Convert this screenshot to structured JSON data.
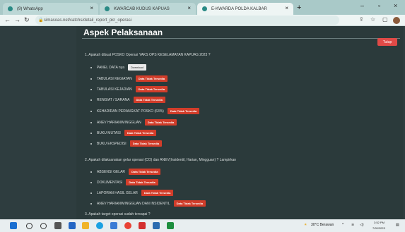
{
  "browser": {
    "tabs": [
      {
        "label": "(9) WhatsApp"
      },
      {
        "label": "KWARCAB KUDUS KAPUAS"
      },
      {
        "label": "E-KWARDA POLDA KALBAR"
      }
    ],
    "new_tab": "+",
    "url": "simasoas.net/catchs/detail_report_pkr_operasi"
  },
  "page": {
    "title": "Aspek Pelaksanaan",
    "close_button": "Tutup",
    "q1": "1. Apakah dibuat POSKO Operasi YAKS OPS KESELAMATAN KAPUAS 2023 ?",
    "q1_items": [
      {
        "label": "PANEL DATA nya",
        "action": "Download",
        "type": "download"
      },
      {
        "label": "TABULASI KEGIATAN",
        "action": "Data Tidak Tersedia",
        "type": "badge"
      },
      {
        "label": "TABULASI KEJADIAN",
        "action": "Data Tidak Tersedia",
        "type": "badge"
      },
      {
        "label": "RENGIAT / SARANA",
        "action": "Data Tidak Tersedia",
        "type": "badge"
      },
      {
        "label": "KEHADIRAN PERANGKAT POSKO (63%)",
        "action": "Data Tidak Tersedia",
        "type": "badge"
      },
      {
        "label": "ANEV HARIAN/MINGGUAN",
        "action": "Data Tidak Tersedia",
        "type": "badge"
      },
      {
        "label": "BUKU MUTASI",
        "action": "Data Tidak Tersedia",
        "type": "badge"
      },
      {
        "label": "BUKU EKSPEDISI",
        "action": "Data Tidak Tersedia",
        "type": "badge"
      }
    ],
    "q2": "2. Apakah dilaksanakan gelar operasi (CO) dan ANEV(Insidentil, Harian, Mingguan) ? Lampirkan",
    "q2_items": [
      {
        "label": "ABSENSI GELAR",
        "action": "Data Tidak Tersedia"
      },
      {
        "label": "DOKUMENTASI",
        "action": "Data Tidak Tersedia"
      },
      {
        "label": "LAPORAN HASIL GELAR",
        "action": "Data Tidak Tersedia"
      },
      {
        "label": "ANEV HARIAN/MINGGUAN DAN INSIDENTIL",
        "action": "Data Tidak Tersedia"
      }
    ],
    "q3": "3. Apakah target operasi sudah tercapai ?"
  },
  "taskbar": {
    "weather": "30°C Berawan",
    "time": "3:52 PM",
    "date": "7/20/2023"
  }
}
